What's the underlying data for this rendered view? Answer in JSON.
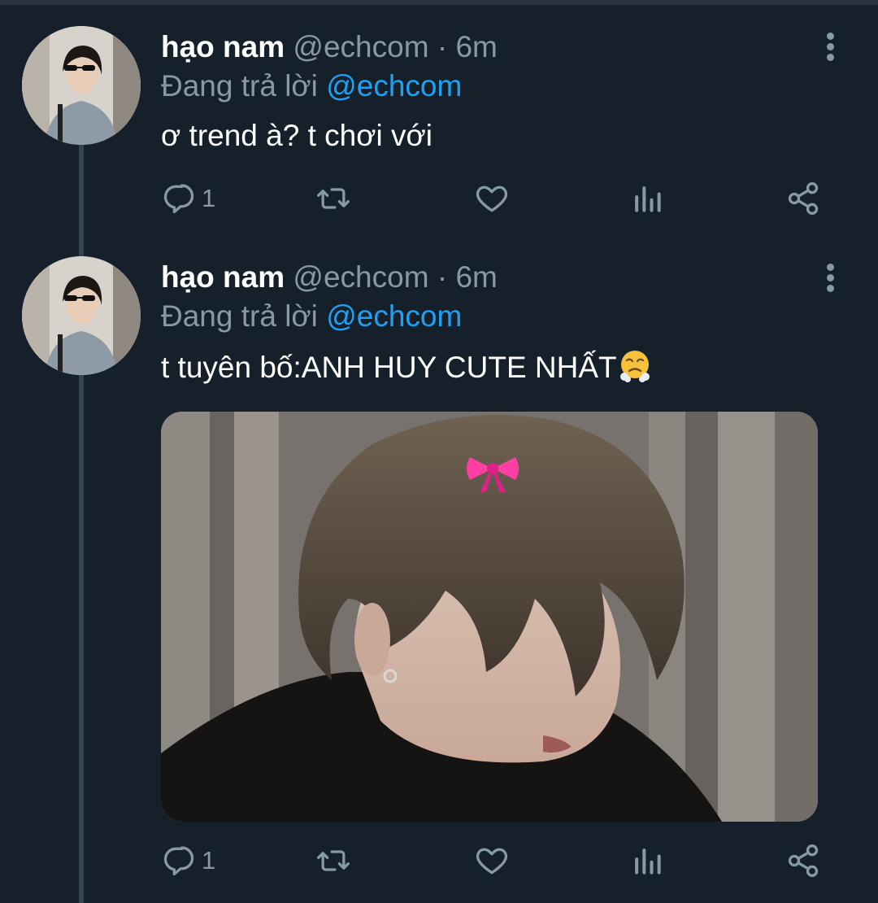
{
  "tweets": [
    {
      "name": "hạo nam",
      "handle": "@echcom",
      "separator": "·",
      "time": "6m",
      "reply_prefix": "Đang trả lời",
      "reply_to": "@echcom",
      "text": "ơ trend à? t chơi với",
      "reply_count": "1"
    },
    {
      "name": "hạo nam",
      "handle": "@echcom",
      "separator": "·",
      "time": "6m",
      "reply_prefix": "Đang trả lời",
      "reply_to": "@echcom",
      "text": "t tuyên bố:ANH HUY CUTE NHẤT",
      "reply_count": "1"
    }
  ],
  "icons": [
    "reply-icon",
    "retweet-icon",
    "like-icon",
    "analytics-icon",
    "share-icon",
    "more-icon"
  ],
  "colors": {
    "background": "#15202b",
    "secondary_text": "#8899a6",
    "accent": "#1da1f2",
    "divider": "#38444d"
  }
}
